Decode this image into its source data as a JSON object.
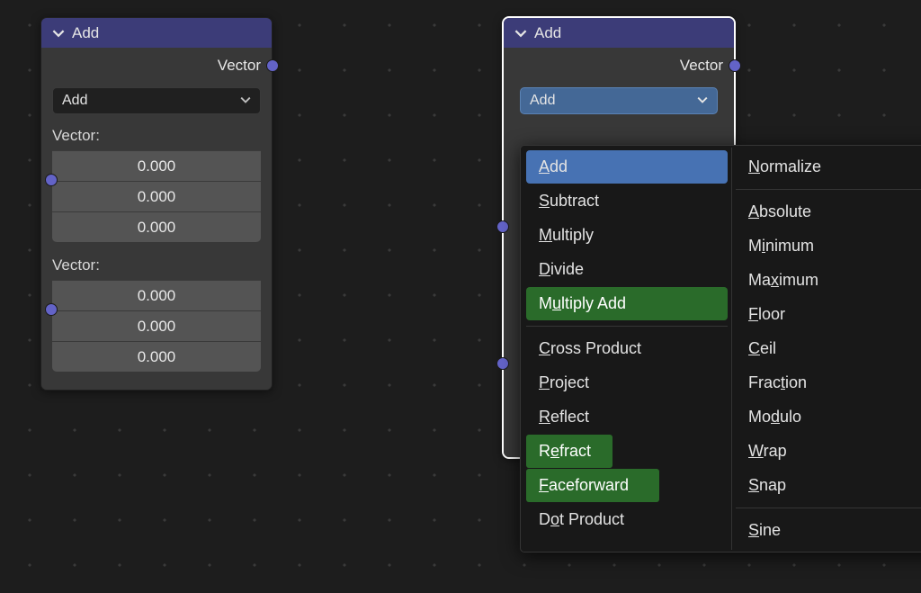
{
  "left_node": {
    "title": "Add",
    "output_label": "Vector",
    "op_selected": "Add",
    "vec1_label": "Vector:",
    "vec2_label": "Vector:",
    "vec1": [
      "0.000",
      "0.000",
      "0.000"
    ],
    "vec2": [
      "0.000",
      "0.000",
      "0.000"
    ]
  },
  "right_node": {
    "title": "Add",
    "output_label": "Vector",
    "op_selected": "Add"
  },
  "menu": {
    "col1": {
      "group1": [
        {
          "label": "Add",
          "selected": true
        },
        {
          "label": "Subtract"
        },
        {
          "label": "Multiply"
        },
        {
          "label": "Divide"
        },
        {
          "label": "Multiply Add",
          "highlight": true
        }
      ],
      "group2": [
        {
          "label": "Cross Product"
        },
        {
          "label": "Project"
        },
        {
          "label": "Reflect"
        },
        {
          "label": "Refract",
          "highlight": true,
          "width": 96
        },
        {
          "label": "Faceforward",
          "highlight": true,
          "width": 148
        },
        {
          "label": "Dot Product"
        }
      ]
    },
    "col2": {
      "group1": [
        {
          "label": "Normalize"
        }
      ],
      "group2": [
        {
          "label": "Absolute"
        },
        {
          "label": "Minimum"
        },
        {
          "label": "Maximum"
        },
        {
          "label": "Floor"
        },
        {
          "label": "Ceil"
        },
        {
          "label": "Fraction"
        },
        {
          "label": "Modulo"
        },
        {
          "label": "Wrap"
        },
        {
          "label": "Snap"
        }
      ],
      "group3": [
        {
          "label": "Sine"
        }
      ]
    }
  }
}
